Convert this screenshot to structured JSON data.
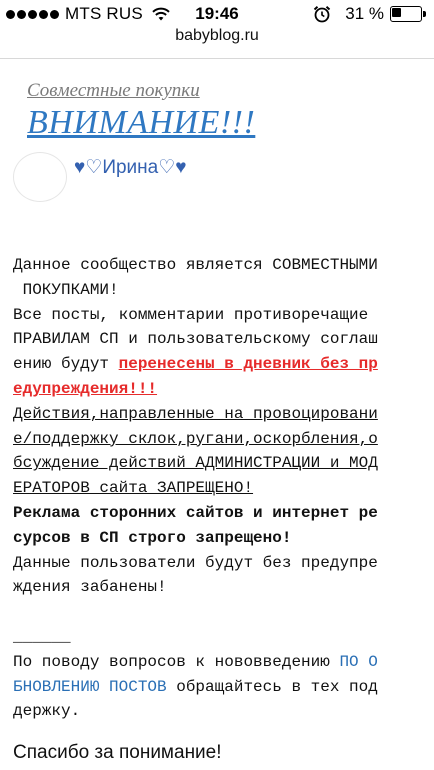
{
  "status_bar": {
    "carrier": "MTS RUS",
    "time": "19:46",
    "battery": "31 %",
    "battery_level": 0.31,
    "icons": [
      "signal-dots",
      "wifi-icon",
      "alarm-icon",
      "battery-icon"
    ]
  },
  "browser": {
    "url": "babyblog.ru"
  },
  "post": {
    "community": "Совместные покупки",
    "title": "ВНИМАНИЕ!!!",
    "author": "♥♡Ирина♡♥",
    "lines": {
      "l1": "Данное сообщество является СОВМЕСТНЫМИ",
      "l2": " ПОКУПКАМИ!",
      "l3": "Все посты, комментарии противоречащие ",
      "l4": "ПРАВИЛАМ СП и пользовательскому соглаш",
      "l5a": "ению будут ",
      "l5b": "перенесены в дневник без пр",
      "l6": "едупреждения!!!",
      "l7": "Действия,направленные на провоцировани",
      "l8": "е/поддержку склок,ругани,оскорбления,о",
      "l9": "бсуждение действий АДМИНИСТРАЦИИ и МОД",
      "l10": "ЕРАТОРОВ сайта ЗАПРЕЩЕНО!",
      "l11": "Реклама сторонних сайтов и интернет ре",
      "l12": "сурсов в СП строго запрещено!",
      "l13": "Данные пользователи будут без предупре",
      "l14": "ждения забанены!",
      "l15": "",
      "l16": "______",
      "l17a": "По поводу вопросов к нововведению ",
      "l17b": "ПО О",
      "l18a": "БНОВЛЕНИЮ ПОСТОВ",
      "l18b": " обращайтесь в тех под",
      "l19": "держку."
    },
    "thanks": "Спасибо за понимание!"
  }
}
